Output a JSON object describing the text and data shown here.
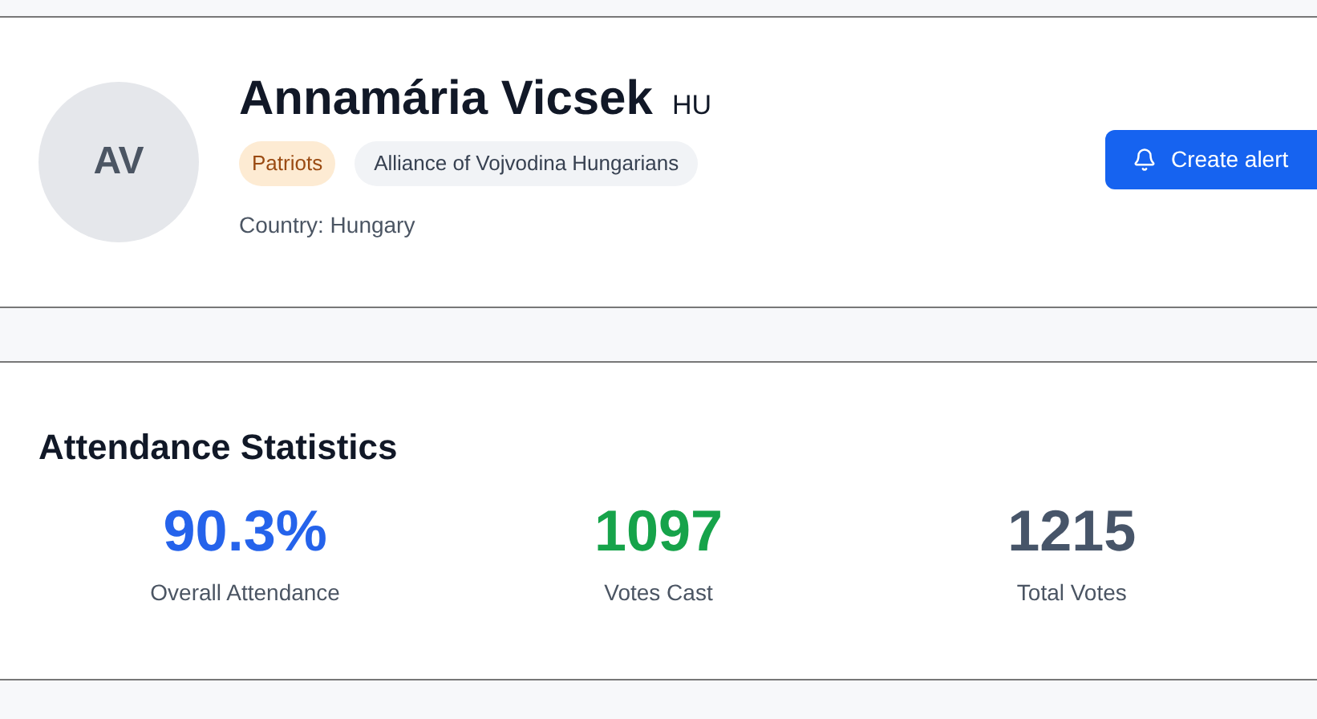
{
  "profile": {
    "initials": "AV",
    "name": "Annamária Vicsek",
    "country_code": "HU",
    "tags": [
      {
        "label": "Patriots",
        "kind": "group"
      },
      {
        "label": "Alliance of Vojvodina Hungarians",
        "kind": "party"
      }
    ],
    "country": "Country: Hungary",
    "alert_button": "Create alert"
  },
  "attendance": {
    "title": "Attendance Statistics",
    "stats": [
      {
        "value": "90.3%",
        "label": "Overall Attendance",
        "color": "#2563eb"
      },
      {
        "value": "1097",
        "label": "Votes Cast",
        "color": "#16a34a"
      },
      {
        "value": "1215",
        "label": "Total Votes",
        "color": "#475569"
      }
    ]
  }
}
